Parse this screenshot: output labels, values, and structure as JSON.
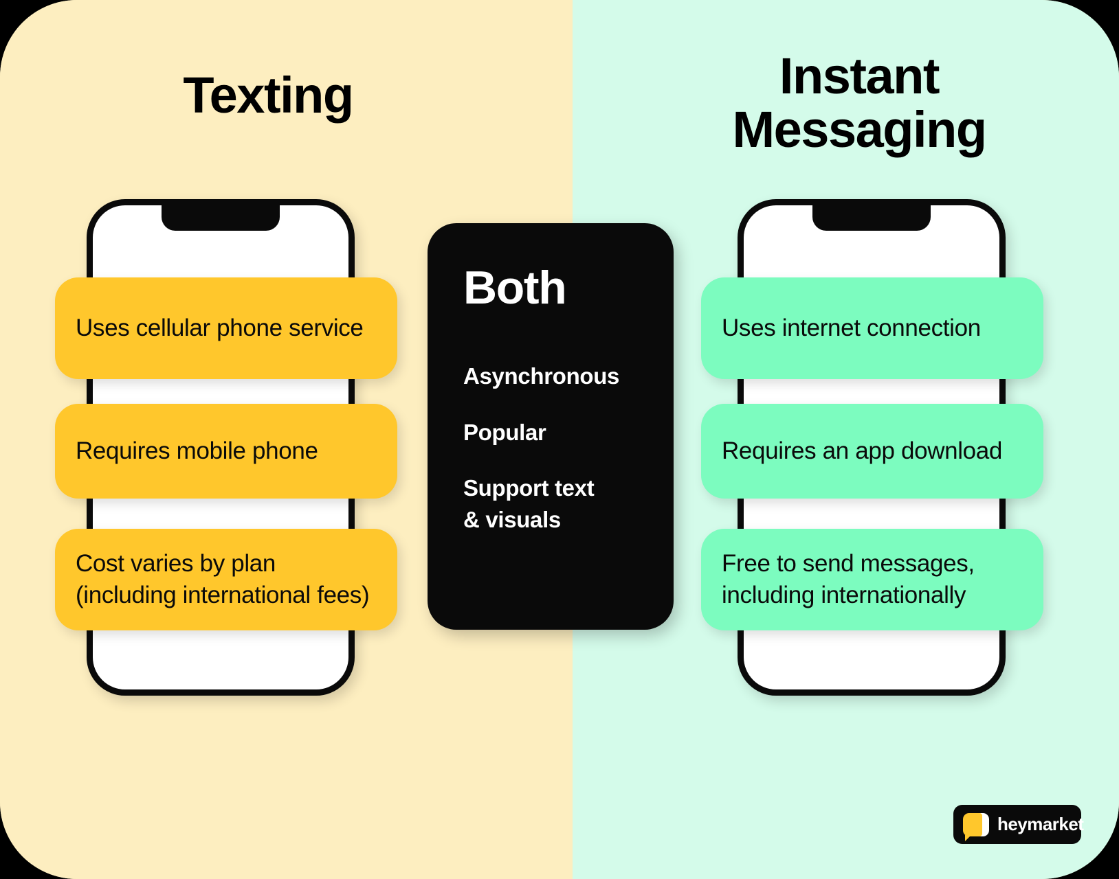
{
  "canvas": {
    "background_left": "#FDEEC0",
    "background_right": "#D4FBEA"
  },
  "columns": {
    "left": {
      "heading": "Texting",
      "pill_color": "#FFC72C",
      "features": [
        {
          "lines": [
            "Uses cellular phone service"
          ]
        },
        {
          "lines": [
            "Requires mobile phone"
          ]
        },
        {
          "lines": [
            "Cost varies by plan",
            "(including international fees)"
          ]
        }
      ]
    },
    "right": {
      "heading_line1": "Instant",
      "heading_line2": "Messaging",
      "pill_color": "#7CFCBF",
      "features": [
        {
          "lines": [
            "Uses internet connection"
          ]
        },
        {
          "lines": [
            "Requires an app download"
          ]
        },
        {
          "lines": [
            "Free to send messages,",
            "including internationally"
          ]
        }
      ]
    }
  },
  "center": {
    "title": "Both",
    "panel_color": "#0A0A0A",
    "items": [
      {
        "lines": [
          "Asynchronous"
        ]
      },
      {
        "lines": [
          "Popular"
        ]
      },
      {
        "lines": [
          "Support text",
          "& visuals"
        ]
      }
    ]
  },
  "logo": {
    "name": "heymarket",
    "badge_color": "#0A0A0A",
    "bubble_color": "#FFC72C"
  }
}
